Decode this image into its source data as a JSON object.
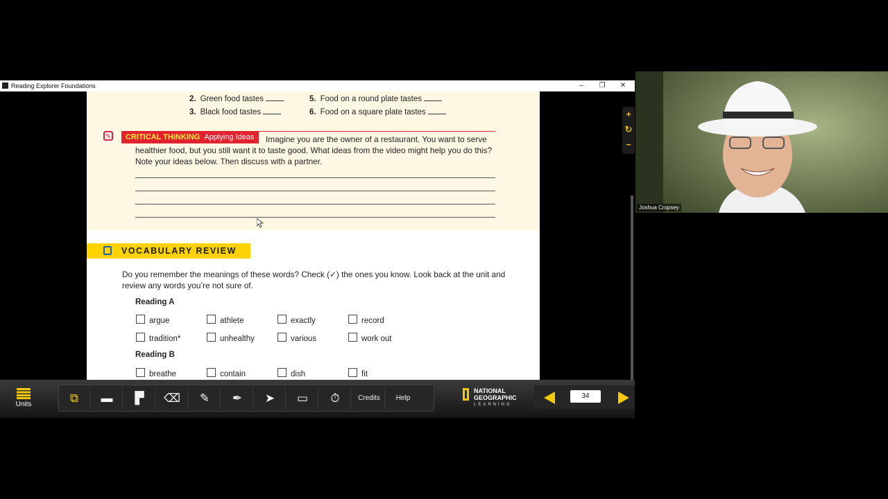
{
  "window": {
    "title": "Reading Explorer Foundations",
    "controls": [
      "–",
      "❐",
      "✕"
    ]
  },
  "questions": [
    {
      "num": "2.",
      "text": "Green food tastes"
    },
    {
      "num": "3.",
      "text": "Black food tastes"
    },
    {
      "num": "5.",
      "text": "Food on a round plate tastes"
    },
    {
      "num": "6.",
      "text": "Food on a square plate tastes"
    }
  ],
  "critical_thinking": {
    "label_bold": "CRITICAL THINKING",
    "label_light": "Applying Ideas",
    "text": "Imagine you are the owner of a restaurant. You want to serve healthier food, but you still want it to taste good. What ideas from the video might help you do this? Note your ideas below. Then discuss with a partner."
  },
  "vocabulary": {
    "title": "VOCABULARY REVIEW",
    "instructions": "Do you remember the meanings of these words? Check (✓) the ones you know. Look back at the unit and review any words you’re not sure of.",
    "reading_a": {
      "heading": "Reading A",
      "words": [
        "argue",
        "athlete",
        "exactly",
        "record",
        "tradition*",
        "unhealthy",
        "various",
        "work out"
      ]
    },
    "reading_b": {
      "heading": "Reading B",
      "words": [
        "breathe",
        "contain",
        "dish",
        "fit"
      ]
    }
  },
  "side_tools": [
    "+",
    "↻",
    "−"
  ],
  "toolbar": {
    "units_label": "Units",
    "tools": [
      {
        "icon": "⧉",
        "name": "pages-icon"
      },
      {
        "icon": "▬",
        "name": "highlighter-icon"
      },
      {
        "icon": "▛",
        "name": "note-icon"
      },
      {
        "icon": "⌫",
        "name": "eraser-icon"
      },
      {
        "icon": "✎",
        "name": "pen-icon"
      },
      {
        "icon": "✒",
        "name": "marker-icon"
      },
      {
        "icon": "➤",
        "name": "pointer-icon"
      },
      {
        "icon": "▭",
        "name": "book-icon"
      },
      {
        "icon": "⏱",
        "name": "timer-icon"
      }
    ],
    "credits_label": "Credits",
    "help_label": "Help",
    "logo_line1": "NATIONAL",
    "logo_line2": "GEOGRAPHIC",
    "logo_line3": "LEARNING",
    "page_number": "34"
  },
  "webcam": {
    "name": "Joshua Cropsey"
  }
}
